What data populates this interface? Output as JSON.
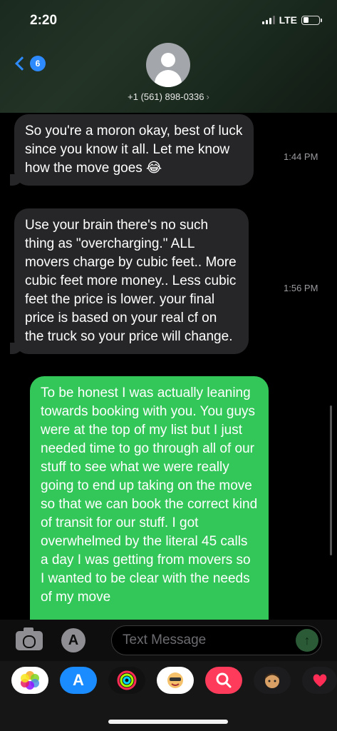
{
  "status": {
    "time": "2:20",
    "network": "LTE"
  },
  "nav": {
    "back_count": "6",
    "contact": "+1 (561) 898-0336",
    "contact_chevron": "›"
  },
  "messages": [
    {
      "text": "So you're a moron okay, best of luck since you know it all. Let me know how the move goes 😂",
      "time": "1:44 PM",
      "direction": "incoming"
    },
    {
      "text": "Use your brain there's no such thing as \"overcharging.\" ALL movers charge by cubic feet.. More cubic feet more money.. Less cubic feet the price is lower. your final price is based on your real cf on the truck so your price will change.",
      "time": "1:56 PM",
      "direction": "incoming"
    },
    {
      "text": "To be honest I was actually leaning towards booking with you. You guys were at the top of my list but I just needed time to go through all of our stuff to see what we were really going to end up taking on the move so that we can book the correct kind of transit for our stuff. I got overwhelmed by the literal 45 calls a day I was getting from movers so I wanted to be clear with the needs of my move",
      "direction": "outgoing"
    }
  ],
  "input": {
    "placeholder": "Text Message",
    "value": ""
  },
  "icons": {
    "camera": "camera-icon",
    "apps": "app-store-icon",
    "send": "send-arrow-icon"
  },
  "drawer_apps": [
    "photos-icon",
    "app-store-icon",
    "activity-rings-icon",
    "memoji-stickers-icon",
    "search-images-icon",
    "memoji-icon",
    "digital-touch-icon"
  ],
  "colors": {
    "accent": "#2e8bff",
    "outgoing_bubble": "#33c759",
    "incoming_bubble": "#262628"
  }
}
